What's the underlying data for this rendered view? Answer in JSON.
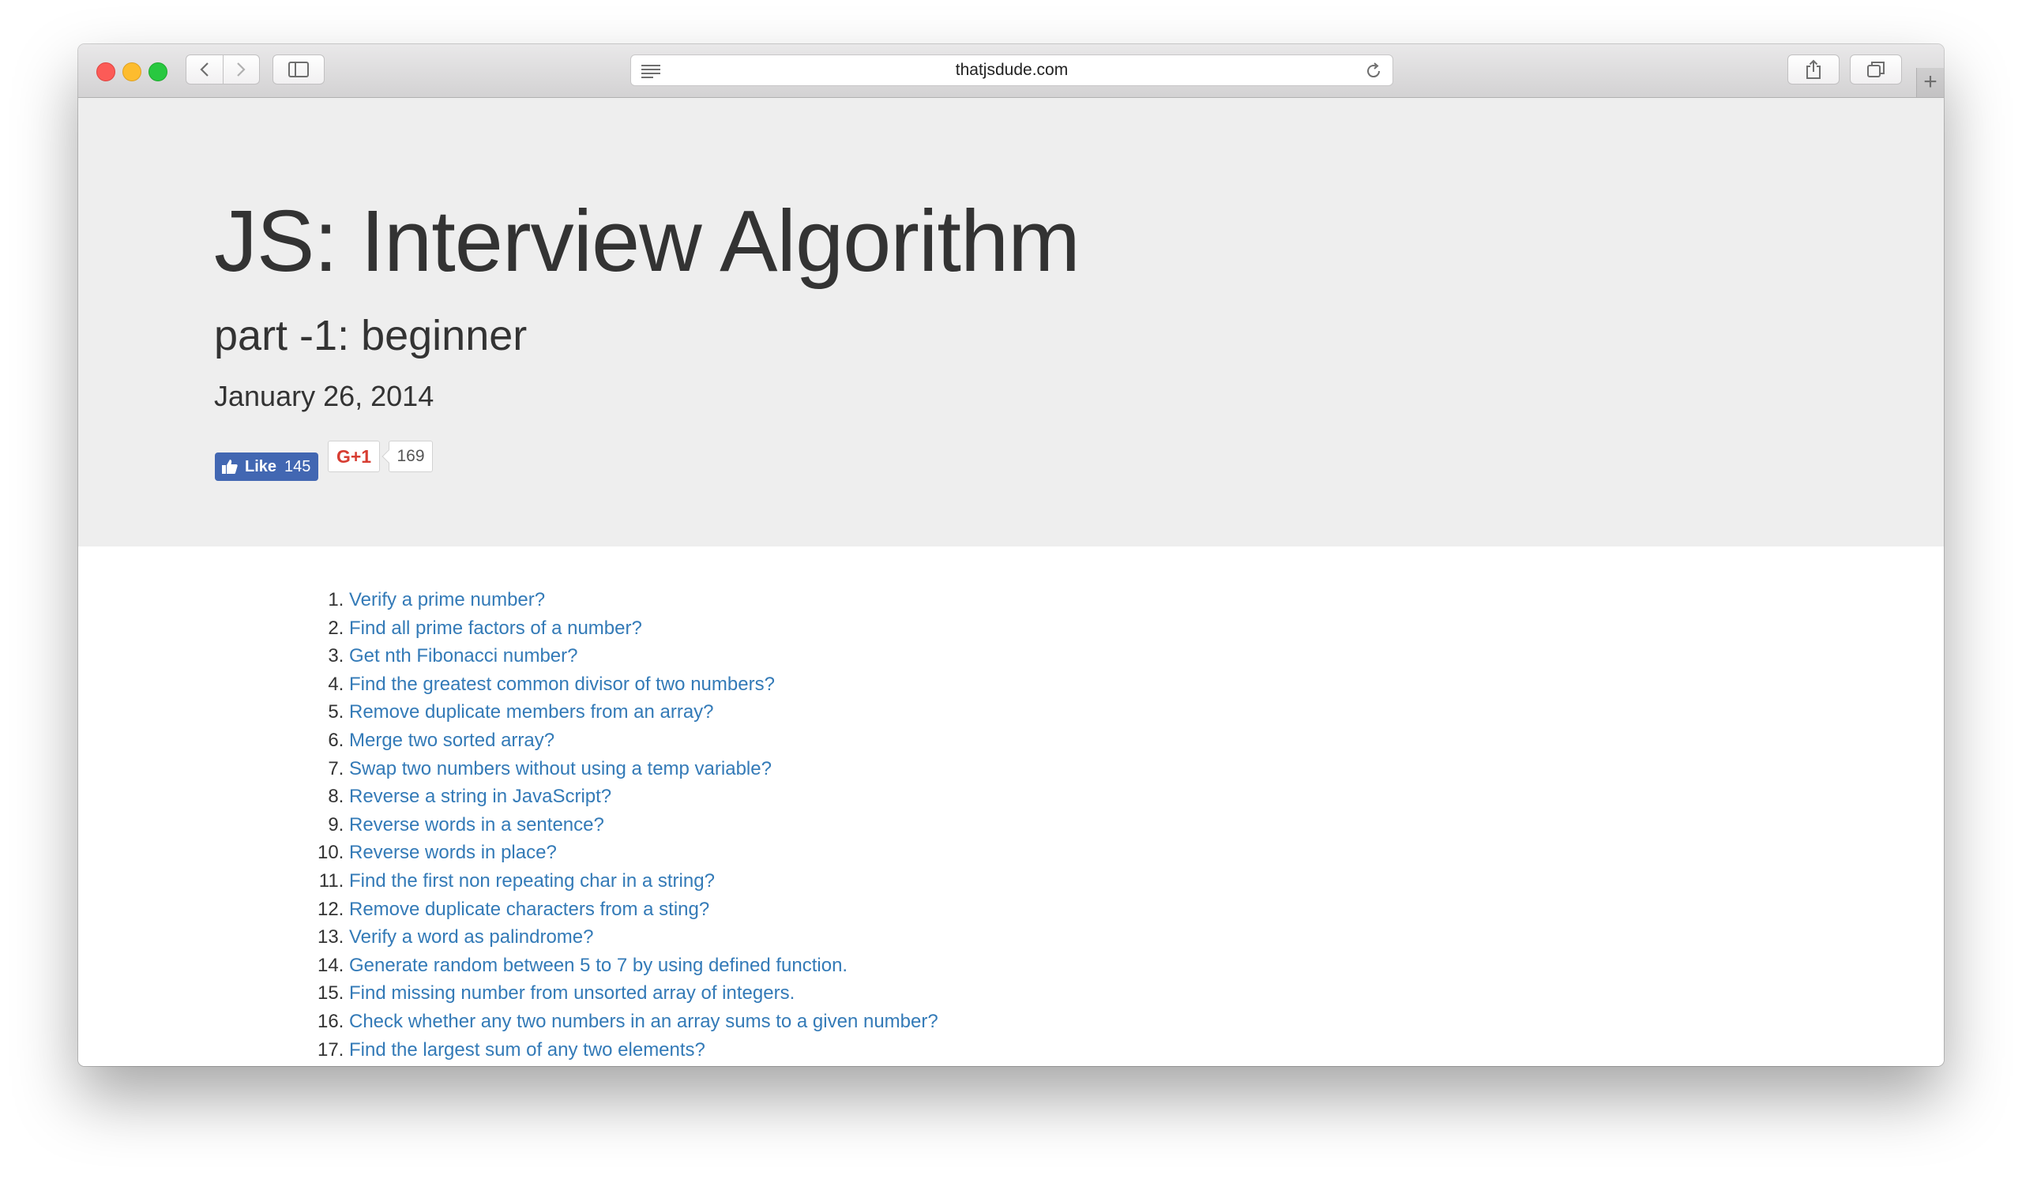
{
  "browser": {
    "url": "thatjsdude.com"
  },
  "header": {
    "title": "JS: Interview Algorithm",
    "subtitle": "part -1: beginner",
    "date": "January 26, 2014"
  },
  "social": {
    "like_label": "Like",
    "like_count": "145",
    "gplus_label": "G+1",
    "gplus_count": "169"
  },
  "questions": [
    "Verify a prime number?",
    "Find all prime factors of a number?",
    "Get nth Fibonacci number?",
    "Find the greatest common divisor of two numbers?",
    "Remove duplicate members from an array?",
    "Merge two sorted array?",
    "Swap two numbers without using a temp variable?",
    "Reverse a string in JavaScript?",
    "Reverse words in a sentence?",
    "Reverse words in place?",
    "Find the first non repeating char in a string?",
    "Remove duplicate characters from a sting?",
    "Verify a word as palindrome?",
    "Generate random between 5 to 7 by using defined function.",
    "Find missing number from unsorted array of integers.",
    "Check whether any two numbers in an array sums to a given number?",
    "Find the largest sum of any two elements?"
  ],
  "colors": {
    "link": "#337ab7",
    "hero_bg": "#eeeeee",
    "facebook": "#4267b2",
    "gplus": "#d73d32"
  }
}
